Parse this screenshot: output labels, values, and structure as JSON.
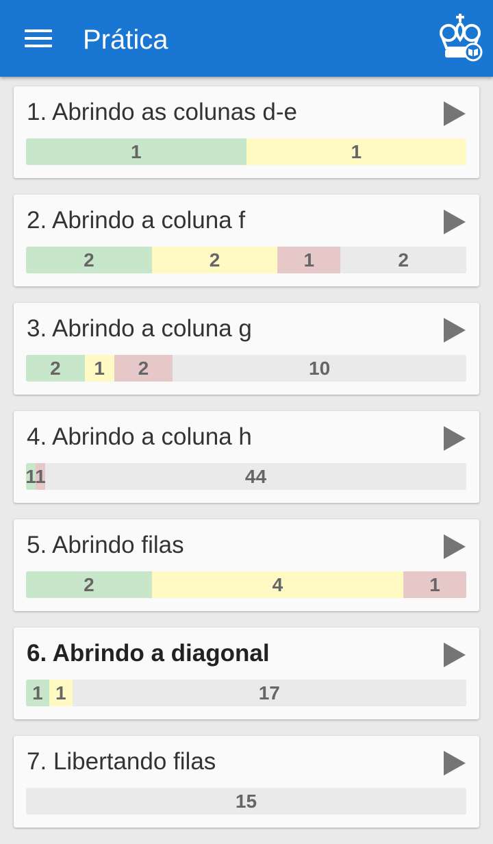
{
  "appbar": {
    "title": "Prática",
    "color": "#1976d2"
  },
  "colors": {
    "solved": "#c8e6c9",
    "partial": "#fff9c4",
    "failed": "#e6c8c8",
    "unsolved": "#eaeaea"
  },
  "lessons": [
    {
      "title": "1. Abrindo as colunas d-e",
      "bold": false,
      "segments": [
        {
          "kind": "green",
          "count": 1,
          "label": "1"
        },
        {
          "kind": "yellow",
          "count": 1,
          "label": "1"
        }
      ]
    },
    {
      "title": "2. Abrindo a coluna f",
      "bold": false,
      "segments": [
        {
          "kind": "green",
          "count": 2,
          "label": "2"
        },
        {
          "kind": "yellow",
          "count": 2,
          "label": "2"
        },
        {
          "kind": "red",
          "count": 1,
          "label": "1"
        },
        {
          "kind": "gray",
          "count": 2,
          "label": "2"
        }
      ]
    },
    {
      "title": "3. Abrindo a coluna g",
      "bold": false,
      "segments": [
        {
          "kind": "green",
          "count": 2,
          "label": "2"
        },
        {
          "kind": "yellow",
          "count": 1,
          "label": "1"
        },
        {
          "kind": "red",
          "count": 2,
          "label": "2"
        },
        {
          "kind": "gray",
          "count": 10,
          "label": "10"
        }
      ]
    },
    {
      "title": "4. Abrindo a coluna h",
      "bold": false,
      "segments": [
        {
          "kind": "green",
          "count": 1,
          "label": "1"
        },
        {
          "kind": "red",
          "count": 1,
          "label": "1"
        },
        {
          "kind": "gray",
          "count": 44,
          "label": "44"
        }
      ]
    },
    {
      "title": "5. Abrindo filas",
      "bold": false,
      "segments": [
        {
          "kind": "green",
          "count": 2,
          "label": "2"
        },
        {
          "kind": "yellow",
          "count": 4,
          "label": "4"
        },
        {
          "kind": "red",
          "count": 1,
          "label": "1"
        }
      ]
    },
    {
      "title": "6. Abrindo a diagonal",
      "bold": true,
      "segments": [
        {
          "kind": "green",
          "count": 1,
          "label": "1"
        },
        {
          "kind": "yellow",
          "count": 1,
          "label": "1"
        },
        {
          "kind": "gray",
          "count": 17,
          "label": "17"
        }
      ]
    },
    {
      "title": "7. Libertando filas",
      "bold": false,
      "segments": [
        {
          "kind": "gray",
          "count": 15,
          "label": "15"
        }
      ]
    }
  ]
}
